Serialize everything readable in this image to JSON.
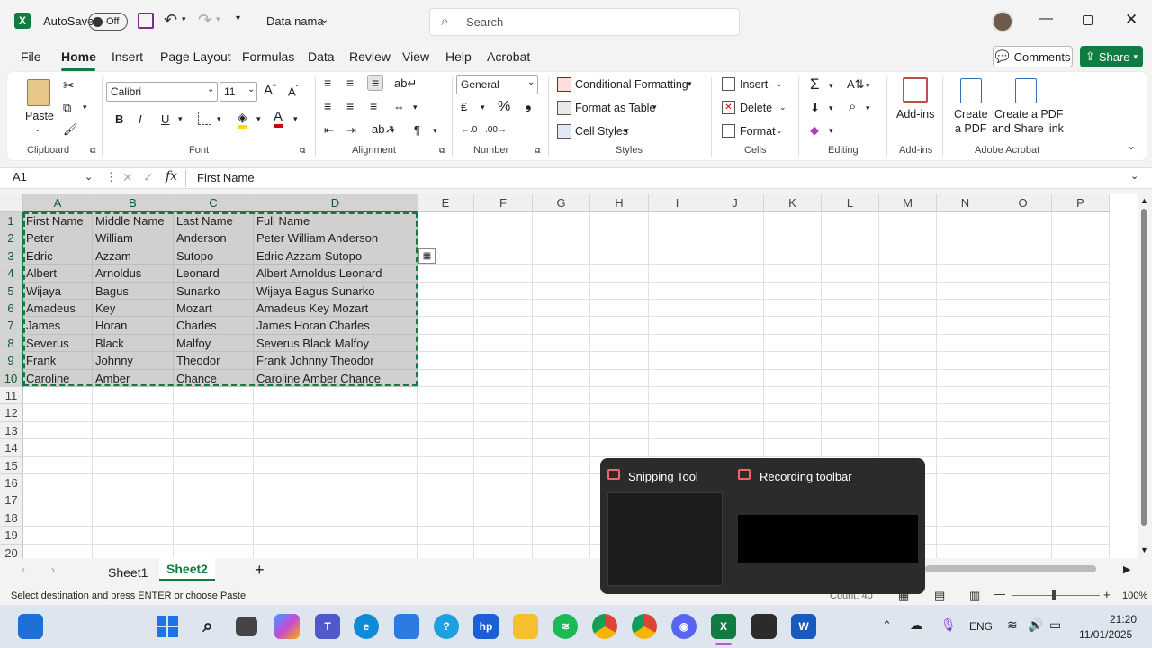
{
  "titlebar": {
    "autosave_label": "AutoSave",
    "autosave_state": "Off",
    "filename": "Data nama",
    "search_placeholder": "Search"
  },
  "menu": {
    "items": [
      "File",
      "Home",
      "Insert",
      "Page Layout",
      "Formulas",
      "Data",
      "Review",
      "View",
      "Help",
      "Acrobat"
    ],
    "active": "Home",
    "comments": "Comments",
    "share": "Share"
  },
  "ribbon": {
    "clipboard": {
      "paste": "Paste",
      "label": "Clipboard"
    },
    "font": {
      "name": "Calibri",
      "size": "11",
      "bold": "B",
      "italic": "I",
      "underline": "U",
      "label": "Font"
    },
    "alignment": {
      "label": "Alignment"
    },
    "number": {
      "format": "General",
      "label": "Number"
    },
    "styles": {
      "conditional": "Conditional Formatting",
      "format_table": "Format as Table",
      "cell_styles": "Cell Styles",
      "label": "Styles"
    },
    "cells": {
      "insert": "Insert",
      "delete": "Delete",
      "format": "Format",
      "label": "Cells"
    },
    "editing": {
      "label": "Editing"
    },
    "addins": {
      "button": "Add-ins",
      "label": "Add-ins"
    },
    "acrobat": {
      "create_pdf_1": "Create",
      "create_pdf_2": "a PDF",
      "create_share_1": "Create a PDF",
      "create_share_2": "and Share link",
      "label": "Adobe Acrobat"
    }
  },
  "formula": {
    "namebox": "A1",
    "fx": "fx",
    "value": "First Name"
  },
  "sheet": {
    "columns": [
      "A",
      "B",
      "C",
      "D",
      "E",
      "F",
      "G",
      "H",
      "I",
      "J",
      "K",
      "L",
      "M",
      "N",
      "O",
      "P"
    ],
    "rows": [
      "1",
      "2",
      "3",
      "4",
      "5",
      "6",
      "7",
      "8",
      "9",
      "10",
      "11",
      "12",
      "13",
      "14",
      "15",
      "16",
      "17",
      "18",
      "19",
      "20"
    ],
    "data": [
      [
        "First Name",
        "Middle Name",
        "Last Name",
        "Full Name"
      ],
      [
        "Peter",
        "William",
        "Anderson",
        "Peter William Anderson"
      ],
      [
        "Edric",
        "Azzam",
        "Sutopo",
        "Edric Azzam Sutopo"
      ],
      [
        "Albert",
        "Arnoldus",
        "Leonard",
        "Albert Arnoldus Leonard"
      ],
      [
        "Wijaya",
        "Bagus",
        "Sunarko",
        "Wijaya Bagus Sunarko"
      ],
      [
        "Amadeus",
        "Key",
        "Mozart",
        "Amadeus Key Mozart"
      ],
      [
        "James",
        "Horan",
        "Charles",
        "James Horan Charles"
      ],
      [
        "Severus",
        "Black",
        "Malfoy",
        "Severus Black Malfoy"
      ],
      [
        "Frank",
        "Johnny",
        "Theodor",
        "Frank Johnny Theodor"
      ],
      [
        "Caroline",
        "Amber",
        "Chance",
        "Caroline Amber Chance"
      ]
    ]
  },
  "tabs": {
    "sheet1": "Sheet1",
    "sheet2": "Sheet2",
    "add": "+"
  },
  "status": {
    "message": "Select destination and press ENTER or choose Paste",
    "count": "Count: 40",
    "zoom": "100%"
  },
  "popup": {
    "item1": "Snipping Tool",
    "item2": "Recording toolbar"
  },
  "taskbar": {
    "lang": "ENG",
    "time": "21:20",
    "date": "11/01/2025"
  },
  "colors": {
    "accent": "#107c41",
    "taskbar": "#dfe5ee"
  }
}
